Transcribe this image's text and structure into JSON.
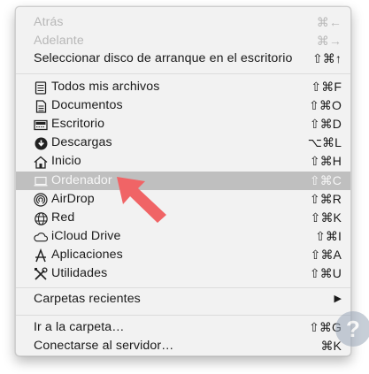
{
  "menu": {
    "top_items": [
      {
        "label": "Atrás",
        "shortcut": "⌘←"
      },
      {
        "label": "Adelante",
        "shortcut": "⌘→"
      },
      {
        "label": "Seleccionar disco de arranque en el escritorio",
        "shortcut": "⇧⌘↑"
      }
    ],
    "places": [
      {
        "label": "Todos mis archivos",
        "shortcut": "⇧⌘F",
        "icon": "all-files-icon"
      },
      {
        "label": "Documentos",
        "shortcut": "⇧⌘O",
        "icon": "documents-icon"
      },
      {
        "label": "Escritorio",
        "shortcut": "⇧⌘D",
        "icon": "desktop-icon"
      },
      {
        "label": "Descargas",
        "shortcut": "⌥⌘L",
        "icon": "downloads-icon"
      },
      {
        "label": "Inicio",
        "shortcut": "⇧⌘H",
        "icon": "home-icon"
      },
      {
        "label": "Ordenador",
        "shortcut": "⇧⌘C",
        "icon": "computer-icon"
      },
      {
        "label": "AirDrop",
        "shortcut": "⇧⌘R",
        "icon": "airdrop-icon"
      },
      {
        "label": "Red",
        "shortcut": "⇧⌘K",
        "icon": "network-icon"
      },
      {
        "label": "iCloud Drive",
        "shortcut": "⇧⌘I",
        "icon": "icloud-icon"
      },
      {
        "label": "Aplicaciones",
        "shortcut": "⇧⌘A",
        "icon": "applications-icon"
      },
      {
        "label": "Utilidades",
        "shortcut": "⇧⌘U",
        "icon": "utilities-icon"
      }
    ],
    "recent": {
      "label": "Carpetas recientes",
      "submenu_glyph": "▶"
    },
    "go_items": [
      {
        "label": "Ir a la carpeta…",
        "shortcut": "⇧⌘G"
      },
      {
        "label": "Conectarse al servidor…",
        "shortcut": "⌘K"
      }
    ]
  },
  "colors": {
    "accent_arrow": "#f06466",
    "selected_row": "#bfbfbf"
  }
}
